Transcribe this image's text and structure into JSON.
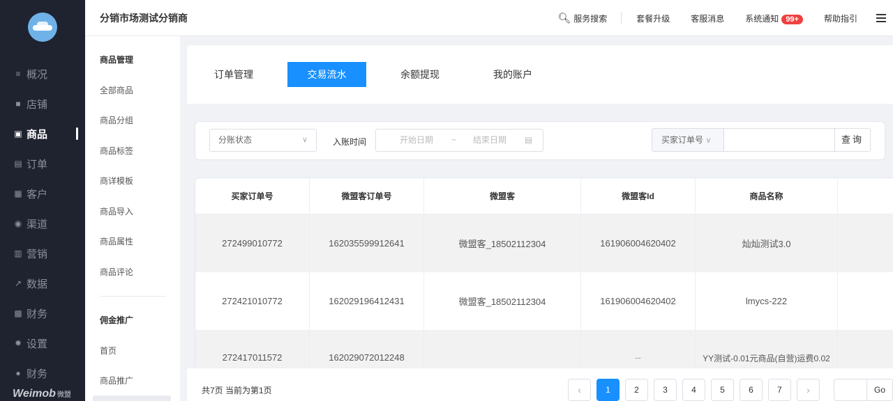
{
  "sidebar": {
    "logo_text": "Weimob",
    "logo_sub": "微盟",
    "items": [
      {
        "icon": "≡",
        "label": "概况"
      },
      {
        "icon": "■",
        "label": "店铺"
      },
      {
        "icon": "▣",
        "label": "商品"
      },
      {
        "icon": "▤",
        "label": "订单"
      },
      {
        "icon": "▦",
        "label": "客户"
      },
      {
        "icon": "◉",
        "label": "渠道"
      },
      {
        "icon": "▥",
        "label": "营销"
      },
      {
        "icon": "↗",
        "label": "数据"
      },
      {
        "icon": "▩",
        "label": "财务"
      },
      {
        "icon": "✹",
        "label": "设置"
      },
      {
        "icon": "●",
        "label": "财务"
      }
    ]
  },
  "header": {
    "title": "分销市场测试分销商",
    "search_label": "服务搜索",
    "links": [
      "套餐升级",
      "客服消息"
    ],
    "notify_label": "系统通知",
    "notify_badge": "99+",
    "help_label": "帮助指引"
  },
  "submenu": {
    "group1": "商品管理",
    "items1": [
      "全部商品",
      "商品分组",
      "商品标签",
      "商详模板",
      "商品导入",
      "商品属性",
      "商品评论"
    ],
    "group2": "佣金推广",
    "items2": [
      "首页",
      "商品推广"
    ]
  },
  "tabs": [
    "订单管理",
    "交易流水",
    "余额提现",
    "我的账户"
  ],
  "filter": {
    "status_placeholder": "分账状态",
    "time_label": "入账时间",
    "start_placeholder": "开始日期",
    "separator": "~",
    "end_placeholder": "结束日期",
    "order_type": "买家订单号",
    "query_label": "查询"
  },
  "table": {
    "columns": [
      "买家订单号",
      "微盟客订单号",
      "微盟客",
      "微盟客Id",
      "商品名称",
      ""
    ],
    "rows": [
      [
        "272499010772",
        "162035599912641",
        "微盟客_18502112304",
        "161906004620402",
        "灿灿测试3.0",
        ""
      ],
      [
        "272421010772",
        "162029196412431",
        "微盟客_18502112304",
        "161906004620402",
        "lmycs-222",
        ""
      ],
      [
        "272417011572",
        "162029072012248",
        "",
        "--",
        "YY测试-0.01元商品(自营)运费0.02",
        ""
      ]
    ]
  },
  "pagination": {
    "info": "共7页 当前为第1页",
    "pages": [
      "1",
      "2",
      "3",
      "4",
      "5",
      "6",
      "7"
    ],
    "current": "1",
    "go_label": "Go"
  }
}
